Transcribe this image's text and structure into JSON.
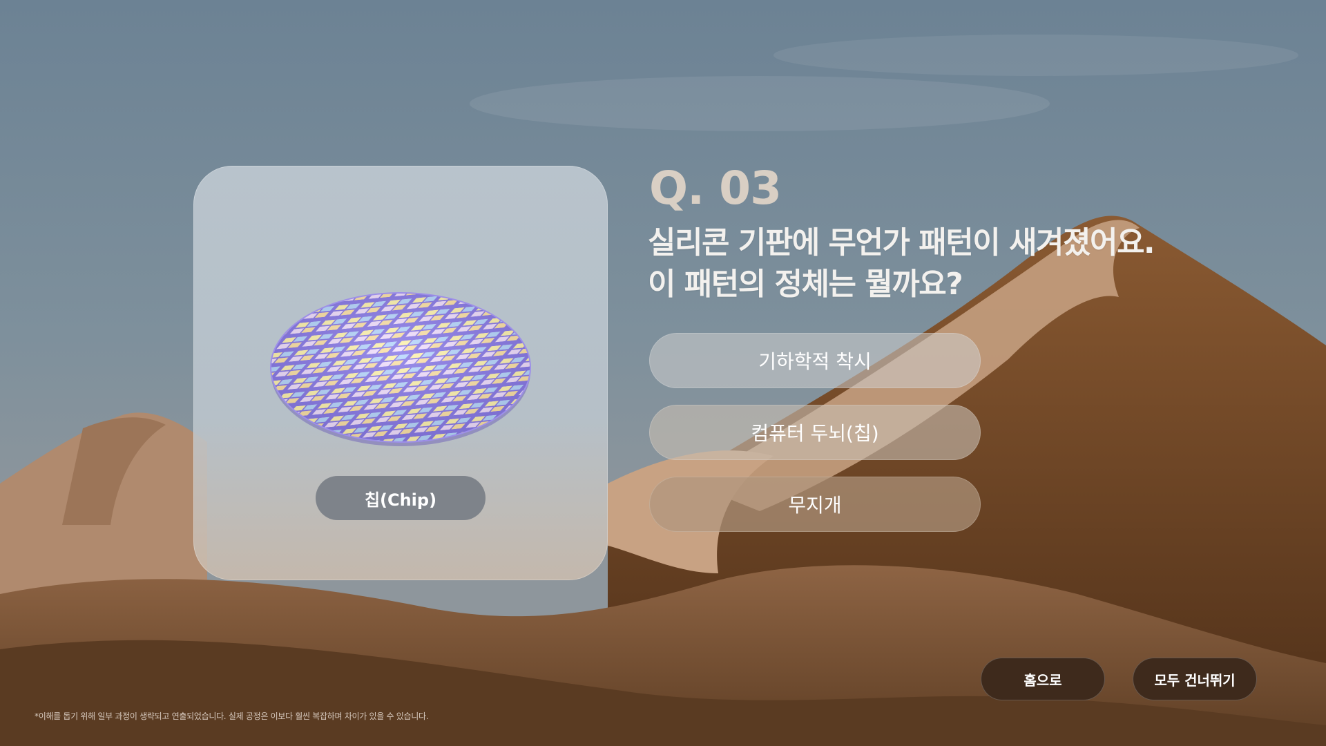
{
  "card": {
    "label": "칩(Chip)"
  },
  "question": {
    "number": "Q. 03",
    "line1": "실리콘 기판에 무언가 패턴이 새겨졌어요.",
    "line2": "이 패턴의 정체는 뭘까요?"
  },
  "options": [
    {
      "label": "기하학적 착시"
    },
    {
      "label": "컴퓨터 두뇌(칩)"
    },
    {
      "label": "무지개"
    }
  ],
  "nav": {
    "home_label": "홈으로",
    "skip_all_label": "모두 건너뛰기"
  },
  "footnote": "*이해를 돕기 위해 일부 과정이 생략되고 연출되었습니다. 실제 공정은 이보다 훨씬 복잡하며 차이가 있을 수 있습니다.",
  "colors": {
    "sky": "#6f8798",
    "sand_dark": "#5a3a1f",
    "sand_light": "#c9a386",
    "button_dark": "#3e2a1c",
    "label_pill": "#7e838a",
    "q_number": "#d9cfc4"
  }
}
